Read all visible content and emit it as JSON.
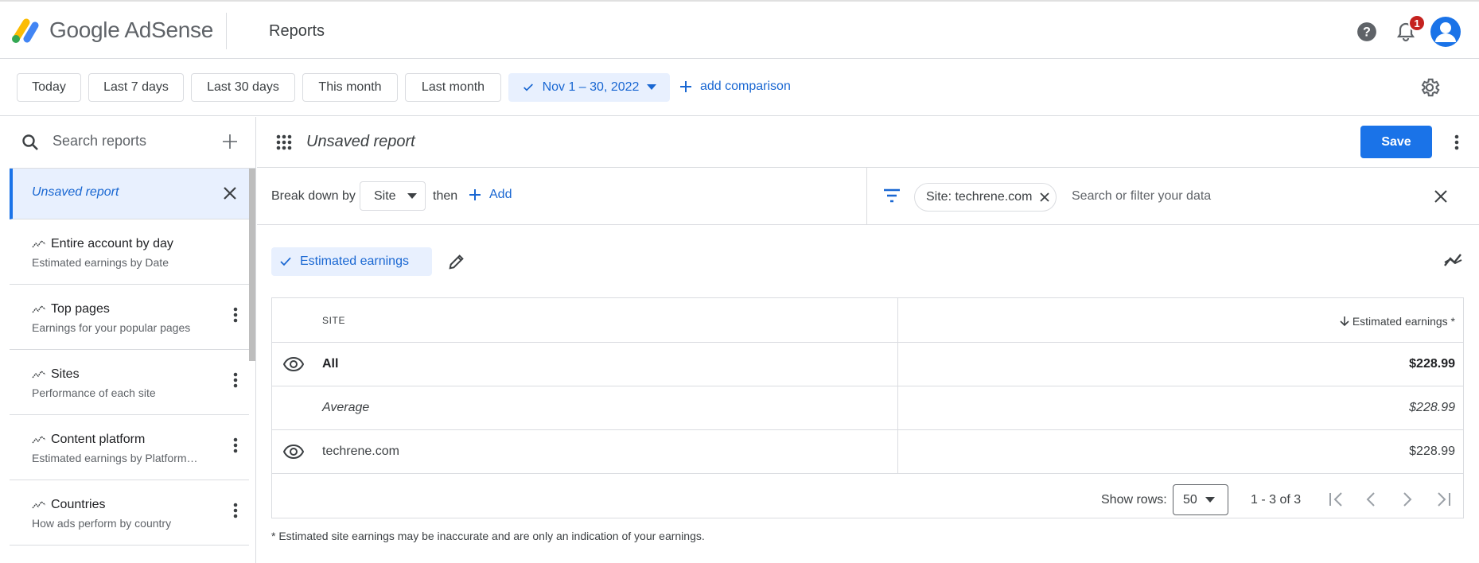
{
  "app": {
    "name": "Google AdSense",
    "page_title": "Reports",
    "notification_count": "1"
  },
  "date_range": {
    "chips": [
      "Today",
      "Last 7 days",
      "Last 30 days",
      "This month",
      "Last month"
    ],
    "selected": "Nov 1 – 30, 2022",
    "add_comparison": "add comparison"
  },
  "sidebar": {
    "search_placeholder": "Search reports",
    "active_report": "Unsaved report",
    "reports": [
      {
        "title": "Entire account by day",
        "subtitle": "Estimated earnings by Date"
      },
      {
        "title": "Top pages",
        "subtitle": "Earnings for your popular pages"
      },
      {
        "title": "Sites",
        "subtitle": "Performance of each site"
      },
      {
        "title": "Content platform",
        "subtitle": "Estimated earnings by Platform…"
      },
      {
        "title": "Countries",
        "subtitle": "How ads perform by country"
      }
    ]
  },
  "report": {
    "name": "Unsaved report",
    "save_label": "Save",
    "breakdown_label": "Break down by",
    "breakdown_value": "Site",
    "then_label": "then",
    "add_label": "Add",
    "filter_chip": "Site: techrene.com",
    "filter_placeholder": "Search or filter your data",
    "metric": "Estimated earnings"
  },
  "table": {
    "columns": [
      "SITE",
      "Estimated earnings *"
    ],
    "rows": [
      {
        "site": "All",
        "value": "$228.99"
      },
      {
        "site": "Average",
        "value": "$228.99"
      },
      {
        "site": "techrene.com",
        "value": "$228.99"
      }
    ],
    "show_rows_label": "Show rows:",
    "rows_per_page": "50",
    "range": "1 - 3 of 3"
  },
  "footnote": "* Estimated site earnings may be inaccurate and are only an indication of your earnings.",
  "colors": {
    "accent": "#1a73e8",
    "active_bg": "#e8f0fe",
    "badge": "#c5221f"
  }
}
